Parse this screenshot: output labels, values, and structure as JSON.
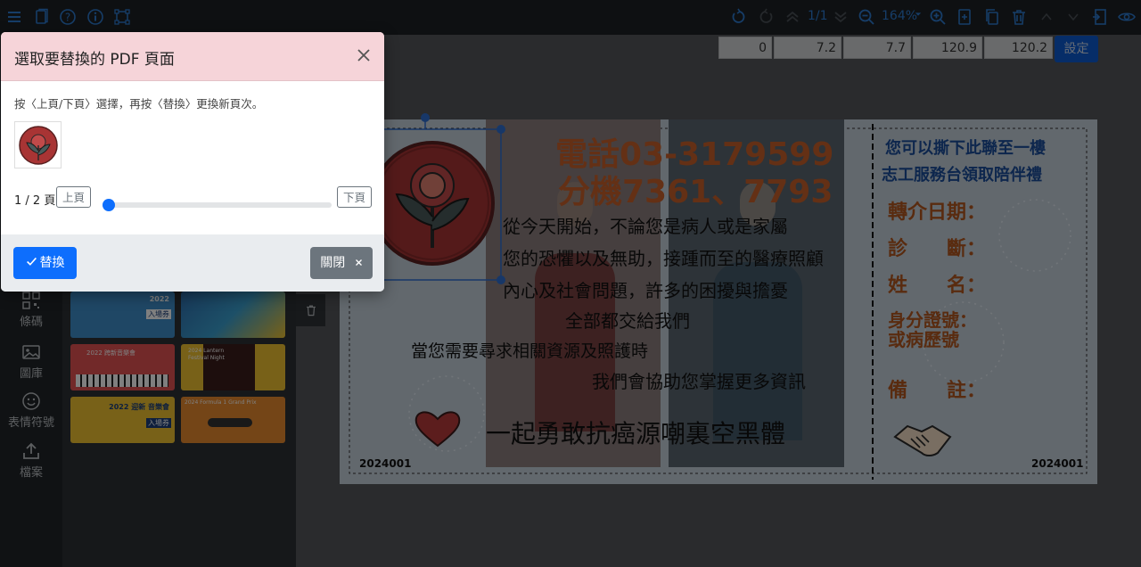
{
  "toolbar": {
    "page_indicator": "1/1",
    "zoom": "164%"
  },
  "sidebar": {
    "items": [
      {
        "label": "條碼"
      },
      {
        "label": "圖庫"
      },
      {
        "label": "表情符號"
      },
      {
        "label": "檔案"
      }
    ]
  },
  "thumbnails": [
    {
      "t1": "2022",
      "t2": "入場券"
    },
    {
      "t1": "",
      "t2": ""
    },
    {
      "t1": "2022 跨新音樂會",
      "t2": ""
    },
    {
      "t1": "2024 Lantern Festival Night",
      "t2": ""
    },
    {
      "t1": "2022 迎新 音樂會",
      "t2": "入場券"
    },
    {
      "t1": "2024 Formula 1 Grand Prix",
      "t2": ""
    }
  ],
  "coords": {
    "values": [
      "0",
      "7.2",
      "7.7",
      "120.9",
      "120.2"
    ],
    "set_label": "設定"
  },
  "ticket": {
    "phone_line1": "電話03-3179599",
    "phone_line2": "分機7361、7793",
    "body": [
      "從今天開始，不論您是病人或是家屬",
      "您的恐懼以及無助，接踵而至的醫療照顧",
      "內心及社會問題，許多的困擾與擔憂",
      "全部都交給我們",
      "當您需要尋求相關資源及照護時",
      "我們會協助您掌握更多資訊"
    ],
    "slogan": "一起勇敢抗癌源嘲裏空黑體",
    "serial_left": "2024001",
    "serial_right": "2024001",
    "stub_line1": "您可以撕下此聯至一樓",
    "stub_line2": "志工服務台領取陪伴禮",
    "fields": [
      "轉介日期：",
      "診　　斷：",
      "姓　　名：",
      "身分證號：",
      "或病歷號",
      "備　　註："
    ]
  },
  "modal": {
    "title": "選取要替換的 PDF 頁面",
    "description": "按〈上頁/下頁〉選擇，再按〈替換〉更換新頁次。",
    "page_count": "1 / 2 頁",
    "prev_label": "上頁",
    "next_label": "下頁",
    "slider_value": 0,
    "replace_label": "替換",
    "close_label": "關閉"
  },
  "colors": {
    "primary": "#0d6efd",
    "modal_header": "#f6d4d9",
    "ticket_orange": "#c8602a",
    "ticket_blue": "#1a4d9a"
  }
}
